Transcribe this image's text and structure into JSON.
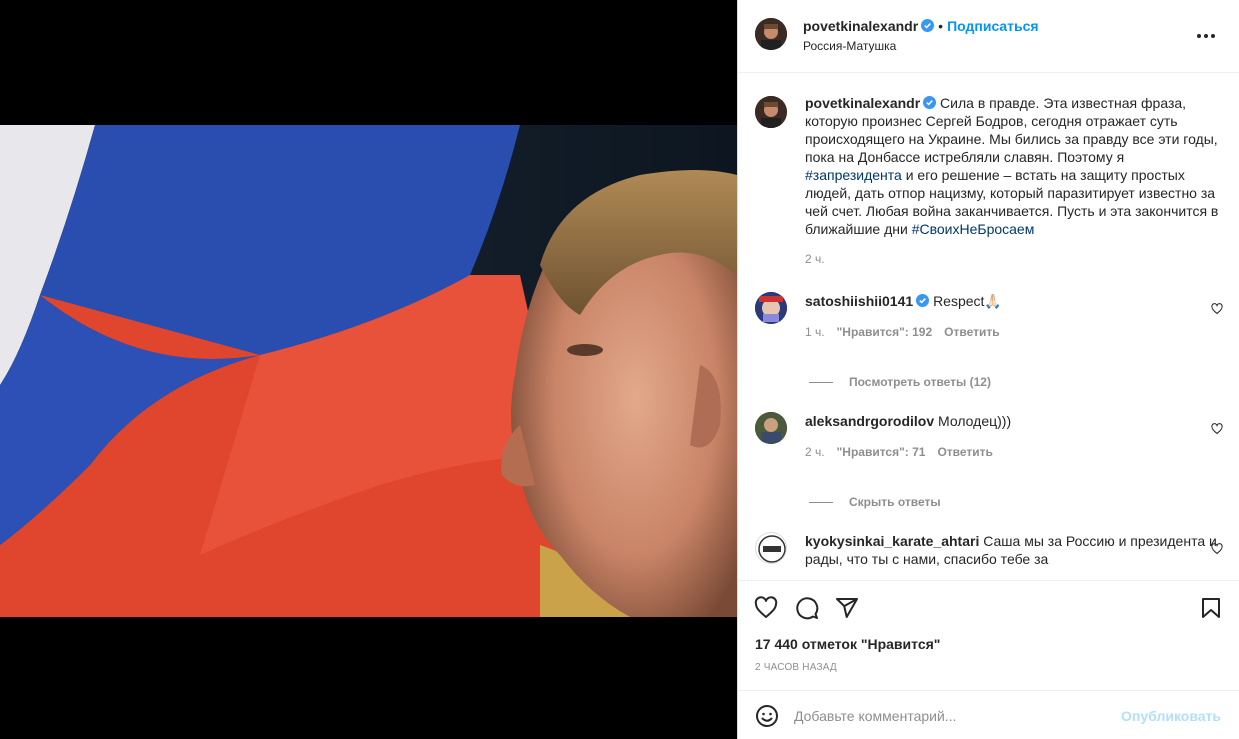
{
  "header": {
    "username": "povetkinalexandr",
    "dot": "•",
    "follow_label": "Подписаться",
    "location": "Россия-Матушка"
  },
  "caption": {
    "username": "povetkinalexandr",
    "text_1": "Сила в правде. Эта известная фраза, которую произнес Сергей Бодров, сегодня отражает суть происходящего на Украине. Мы бились за правду все эти годы, пока на Донбассе истребляли славян. Поэтому я ",
    "hashtag_1": "#запрезидента",
    "text_2": " и его решение – встать на защиту простых людей, дать отпор нацизму, который паразитирует известно за чей счет. Любая война заканчивается. Пусть и эта закончится в ближайшие дни ",
    "hashtag_2": "#СвоихНеБросаем",
    "time": "2 ч."
  },
  "comments": [
    {
      "username": "satoshiishii0141",
      "text": "Respect🙏🏻",
      "time": "1 ч.",
      "likes": "\"Нравится\": 192",
      "reply": "Ответить",
      "replies_toggle": "Посмотреть ответы (12)"
    },
    {
      "username": "aleksandrgorodilov",
      "text": "Молодец)))",
      "time": "2 ч.",
      "likes": "\"Нравится\": 71",
      "reply": "Ответить",
      "replies_toggle": "Скрыть ответы"
    },
    {
      "username": "kyokysinkai_karate_ahtari",
      "text": "Саша мы за Россию и президента и рады, что ты с нами, спасибо тебе за"
    }
  ],
  "actions": {
    "likes_count": "17 440 отметок \"Нравится\"",
    "time_ago": "2 ЧАСОВ НАЗАД"
  },
  "add_comment": {
    "placeholder": "Добавьте комментарий...",
    "publish_label": "Опубликовать"
  },
  "colors": {
    "accent": "#0095f6",
    "hashtag": "#00376b",
    "secondary_text": "#8e8e8e",
    "publish_disabled": "#b2dffc"
  }
}
